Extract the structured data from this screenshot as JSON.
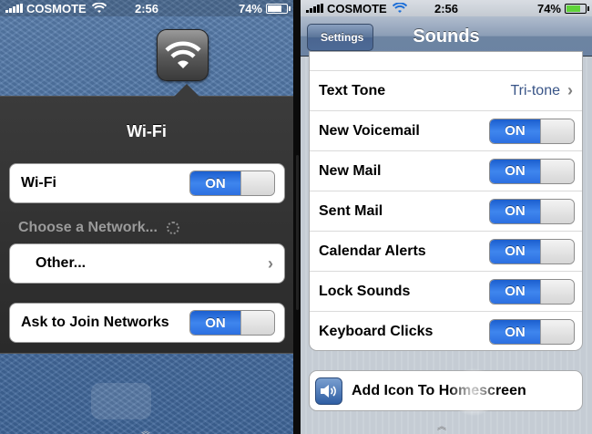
{
  "left": {
    "status": {
      "carrier": "COSMOTE",
      "time": "2:56",
      "battery": "74%"
    },
    "popup": {
      "title": "Wi-Fi",
      "wifi_row": {
        "label": "Wi-Fi",
        "switch": "ON"
      },
      "section_label": "Choose a Network...",
      "other_row": {
        "label": "Other..."
      },
      "ask_row": {
        "label": "Ask to Join Networks",
        "switch": "ON"
      }
    }
  },
  "right": {
    "status": {
      "carrier": "COSMOTE",
      "time": "2:56",
      "battery": "74%"
    },
    "navbar": {
      "back": "Settings",
      "title": "Sounds"
    },
    "rows": [
      {
        "label": "Text Tone",
        "value": "Tri-tone"
      },
      {
        "label": "New Voicemail",
        "switch": "ON"
      },
      {
        "label": "New Mail",
        "switch": "ON"
      },
      {
        "label": "Sent Mail",
        "switch": "ON"
      },
      {
        "label": "Calendar Alerts",
        "switch": "ON"
      },
      {
        "label": "Lock Sounds",
        "switch": "ON"
      },
      {
        "label": "Keyboard Clicks",
        "switch": "ON"
      }
    ],
    "add_icon_row": {
      "label": "Add Icon To Homescreen",
      "icon": "speaker-icon"
    }
  },
  "colors": {
    "switch_on": "#2c6fe0",
    "nav_bar": "#6d84a2",
    "value_text": "#385487"
  }
}
